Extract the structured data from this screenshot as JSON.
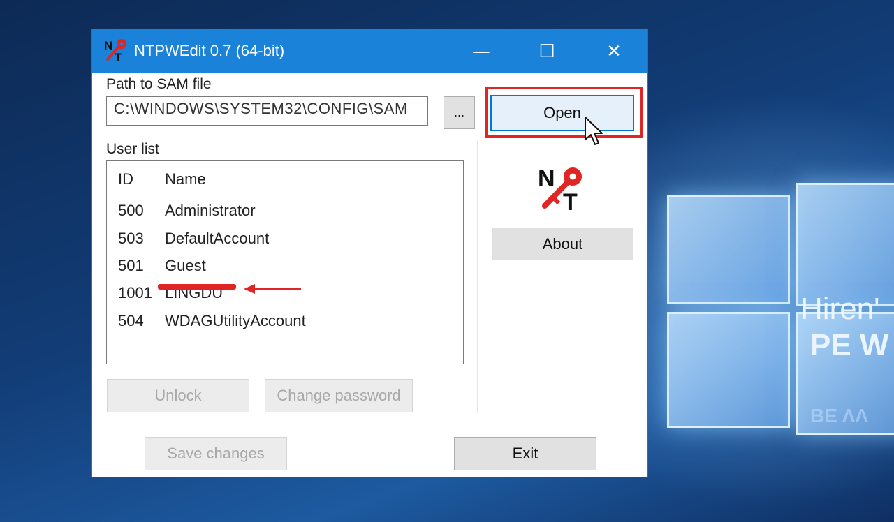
{
  "window": {
    "title": "NTPWEdit 0.7 (64-bit)",
    "controls": {
      "minimize": "—",
      "maximize": "☐",
      "close": "✕"
    }
  },
  "path": {
    "label": "Path to SAM file",
    "value": "C:\\WINDOWS\\SYSTEM32\\CONFIG\\SAM",
    "browse_label": "...",
    "open_label": "Open"
  },
  "userlist": {
    "label": "User list",
    "columns": {
      "id": "ID",
      "name": "Name"
    },
    "rows": [
      {
        "id": "500",
        "name": "Administrator"
      },
      {
        "id": "503",
        "name": "DefaultAccount"
      },
      {
        "id": "501",
        "name": "Guest"
      },
      {
        "id": "1001",
        "name": "LINGDU"
      },
      {
        "id": "504",
        "name": "WDAGUtilityAccount"
      }
    ]
  },
  "buttons": {
    "about": "About",
    "unlock": "Unlock",
    "change_password": "Change password",
    "save_changes": "Save changes",
    "exit": "Exit"
  },
  "wallpaper": {
    "line1": "Hiren'",
    "line2": "PE W",
    "line3": "ΒΕ ΛΛ"
  },
  "colors": {
    "titlebar": "#1a82d8",
    "highlight": "#e02525",
    "accent": "#0078d7"
  }
}
